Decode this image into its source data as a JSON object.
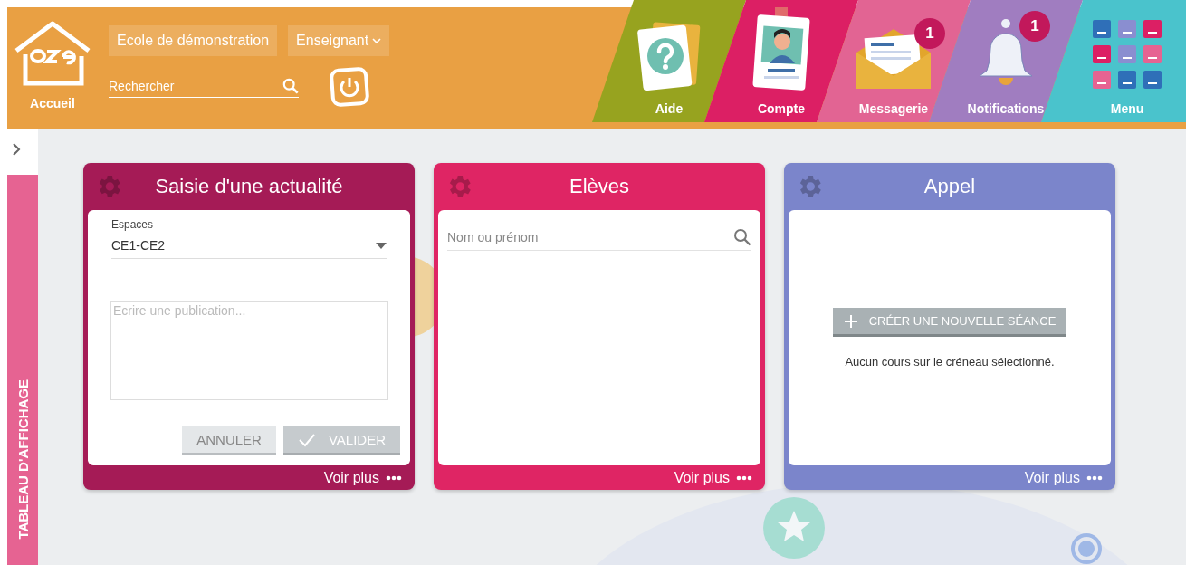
{
  "header": {
    "home_label": "Accueil",
    "school": "Ecole de démonstration",
    "role": "Enseignant",
    "search": {
      "placeholder": "Rechercher"
    }
  },
  "nav": [
    {
      "label": "Aide",
      "kind": "help",
      "color": "#97a31f"
    },
    {
      "label": "Compte",
      "kind": "account",
      "color": "#dc1f64"
    },
    {
      "label": "Messagerie",
      "kind": "mail",
      "color": "#e26493",
      "badge": "1"
    },
    {
      "label": "Notifications",
      "kind": "bell",
      "color": "#a07dc0",
      "badge": "1"
    },
    {
      "label": "Menu",
      "kind": "apps",
      "color": "#4ac3cc"
    }
  ],
  "sidebar": {
    "tab": "TABLEAU D'AFFICHAGE"
  },
  "cards": [
    {
      "kind": "post",
      "title": "Saisie d'une actualité",
      "color": "#a51b56",
      "select_label": "Espaces",
      "select_value": "CE1-CE2",
      "placeholder": "Ecrire une publication...",
      "buttons": [
        "ANNULER",
        "VALIDER"
      ],
      "footer": "Voir plus"
    },
    {
      "kind": "search",
      "title": "Elèves",
      "color": "#df2564",
      "placeholder": "Nom ou prénom",
      "footer": "Voir plus"
    },
    {
      "kind": "empty",
      "title": "Appel",
      "color": "#7b85cb",
      "button": "CRÉER UNE NOUVELLE SÉANCE",
      "message": "Aucun cours sur le créneau sélectionné.",
      "footer": "Voir plus"
    }
  ]
}
